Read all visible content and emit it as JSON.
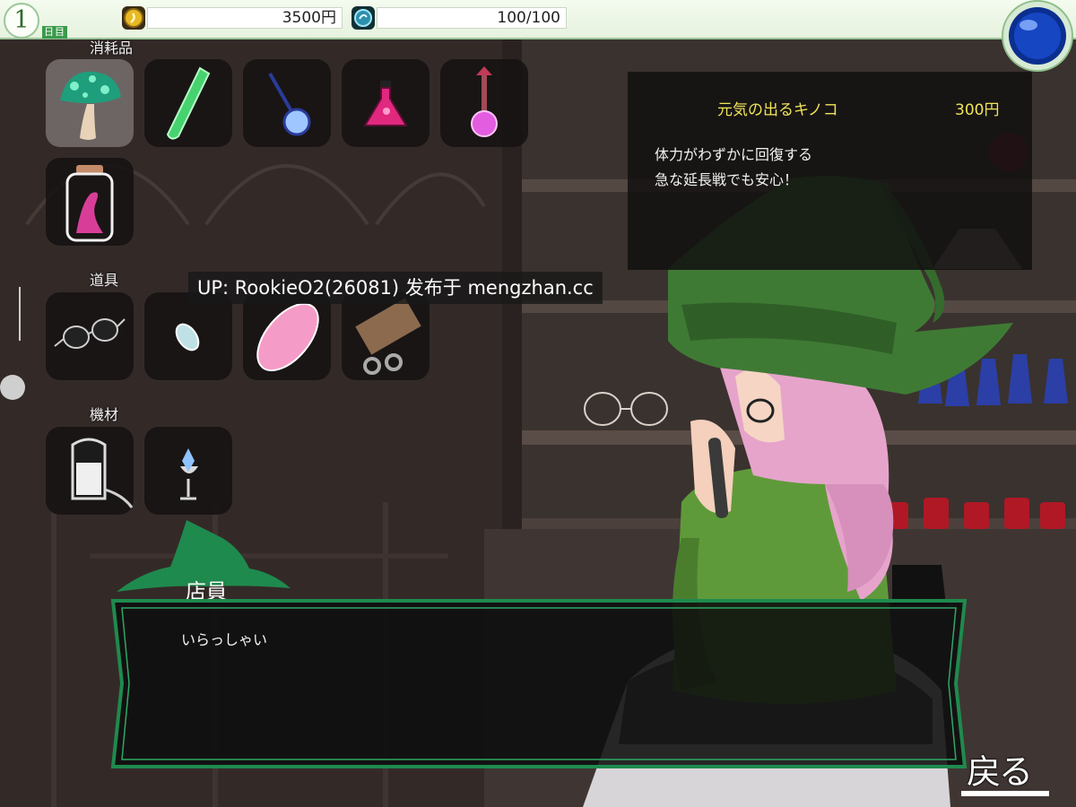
{
  "status": {
    "day_number": "1",
    "day_unit": "日目",
    "money": "3500円",
    "hp": "100/100"
  },
  "sections": {
    "consumables": "消耗品",
    "tools": "道具",
    "equipment": "機材"
  },
  "items": {
    "consumables": [
      {
        "icon": "mushroom-icon"
      },
      {
        "icon": "green-test-tube-icon"
      },
      {
        "icon": "blue-flask-icon"
      },
      {
        "icon": "pink-erlenmeyer-flask-icon"
      },
      {
        "icon": "pink-potion-syringe-icon"
      },
      {
        "icon": "pink-slime-jar-icon"
      }
    ],
    "tools": [
      {
        "icon": "glasses-icon"
      },
      {
        "icon": "crystal-drop-icon"
      },
      {
        "icon": "pink-egg-icon"
      },
      {
        "icon": "shackle-board-icon"
      }
    ],
    "equipment": [
      {
        "icon": "milking-machine-icon"
      },
      {
        "icon": "crystal-chalice-icon"
      }
    ]
  },
  "selected_item": {
    "name": "元気の出るキノコ",
    "price": "300円",
    "description": [
      "体力がわずかに回復する",
      "急な延長戦でも安心！"
    ]
  },
  "watermark": "UP: RookieO2(26081) 发布于 mengzhan.cc",
  "dialog": {
    "speaker": "店員",
    "text": "いらっしゃい"
  },
  "back_button": "戻る",
  "colors": {
    "accent_green": "#1f8a4d",
    "price_yellow": "#f1e35a",
    "hat_green": "#3f7a35"
  }
}
